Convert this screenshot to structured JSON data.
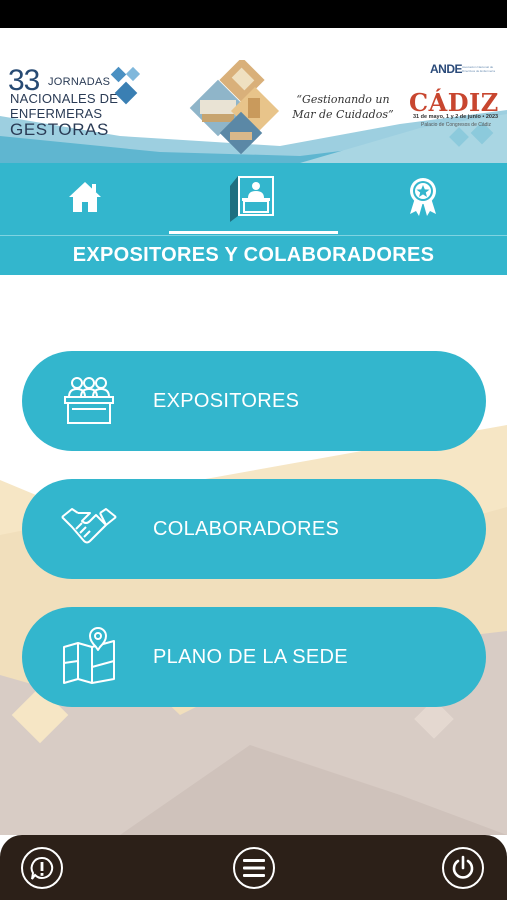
{
  "banner": {
    "logo_number": "33",
    "logo_line1": "JORNADAS",
    "logo_line2": "NACIONALES DE",
    "logo_line3": "ENFERMERAS",
    "logo_line4": "GESTORAS",
    "tagline": "“Gestionando un Mar de Cuidados”",
    "partner_logo": "ANDE",
    "partner_subtitle": "Asociación Nacional de Directivos de Enfermería",
    "city": "CÁDIZ",
    "dates": "31 de mayo, 1 y 2 de junio • 2023",
    "venue": "Palacio de Congresos de Cádiz"
  },
  "nav": {
    "items": [
      {
        "icon": "house-icon",
        "active": false
      },
      {
        "icon": "exhibitor-stand-icon",
        "active": true
      },
      {
        "icon": "award-badge-icon",
        "active": false
      }
    ]
  },
  "section": {
    "title": "EXPOSITORES Y COLABORADORES"
  },
  "menu": {
    "items": [
      {
        "label": "EXPOSITORES",
        "icon": "exhibitors-icon"
      },
      {
        "label": "COLABORADORES",
        "icon": "handshake-icon"
      },
      {
        "label": "PLANO DE LA SEDE",
        "icon": "map-pin-icon"
      }
    ]
  },
  "bottom": {
    "left_icon": "info-exclamation-icon",
    "center_icon": "menu-lines-icon",
    "right_icon": "power-icon"
  },
  "colors": {
    "primary": "#33b6cd",
    "bottom_bar": "#2c2018",
    "sand": "#f6e6c5",
    "taupe": "#d8ccc5"
  }
}
